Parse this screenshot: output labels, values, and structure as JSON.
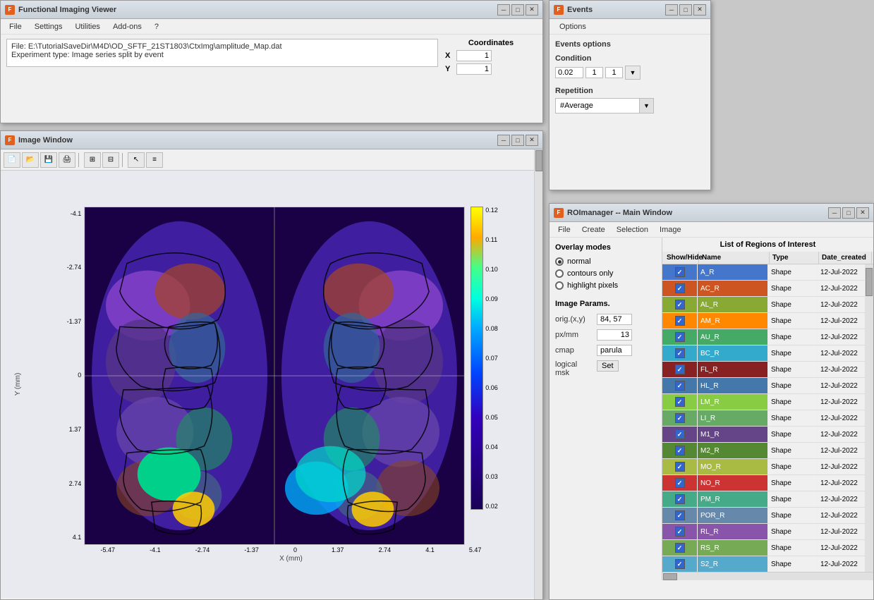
{
  "main_viewer": {
    "title": "Functional Imaging Viewer",
    "file_info": "File: E:\\TutorialSaveDir\\M4D\\OD_SFTF_21ST1803\\CtxImg\\amplitude_Map.dat\nExperiment type: Image series split by event",
    "coordinates": {
      "label": "Coordinates",
      "x_label": "X",
      "y_label": "Y",
      "x_value": "1",
      "y_value": "1"
    },
    "menu": [
      "File",
      "Settings",
      "Utilities",
      "Add-ons",
      "?"
    ]
  },
  "image_window": {
    "title": "Image Window",
    "toolbar_buttons": [
      "new",
      "open",
      "save",
      "print",
      "sep",
      "tool1",
      "tool2",
      "sep",
      "pointer",
      "info"
    ],
    "y_axis_labels": [
      "-4.1",
      "-2.74",
      "-1.37",
      "0",
      "1.37",
      "2.74",
      "4.1"
    ],
    "x_axis_labels": [
      "-5.47",
      "-4.1",
      "-2.74",
      "-1.37",
      "0",
      "1.37",
      "2.74",
      "4.1",
      "5.47"
    ],
    "x_axis_title": "X (mm)",
    "y_axis_title": "Y (mm)",
    "colorbar_labels": [
      "0.12",
      "0.11",
      "0.10",
      "0.09",
      "0.08",
      "0.07",
      "0.06",
      "0.05",
      "0.04",
      "0.03",
      "0.02"
    ]
  },
  "events_window": {
    "title": "Events",
    "options_menu": "Options",
    "events_options_title": "Events options",
    "condition_label": "Condition",
    "condition_value": "0.02",
    "condition_v1": "1",
    "condition_v2": "1",
    "repetition_label": "Repetition",
    "repetition_value": "#Average"
  },
  "roi_manager": {
    "title": "ROImanager -- Main Window",
    "menu": [
      "File",
      "Create",
      "Selection",
      "Image"
    ],
    "list_title": "List of Regions of Interest",
    "overlay_title": "Overlay modes",
    "overlay_options": [
      "normal",
      "contours only",
      "highlight pixels"
    ],
    "selected_overlay": "normal",
    "image_params_title": "Image Params.",
    "params": [
      {
        "label": "orig.(x,y)",
        "value": "84, 57"
      },
      {
        "label": "px/mm",
        "value": "13"
      },
      {
        "label": "cmap",
        "value": "parula"
      },
      {
        "label": "logical\nmsk",
        "btn": "Set"
      }
    ],
    "table_headers": [
      "Show/Hide",
      "Name",
      "Type",
      "Date_created"
    ],
    "rois": [
      {
        "name": "A_R",
        "type": "Shape",
        "date": "12-Jul-2022",
        "color": "#4477cc",
        "checked": true
      },
      {
        "name": "AC_R",
        "type": "Shape",
        "date": "12-Jul-2022",
        "color": "#cc5522",
        "checked": true
      },
      {
        "name": "AL_R",
        "type": "Shape",
        "date": "12-Jul-2022",
        "color": "#88aa33",
        "checked": true
      },
      {
        "name": "AM_R",
        "type": "Shape",
        "date": "12-Jul-2022",
        "color": "#ff8800",
        "checked": true
      },
      {
        "name": "AU_R",
        "type": "Shape",
        "date": "12-Jul-2022",
        "color": "#44aa66",
        "checked": true
      },
      {
        "name": "BC_R",
        "type": "Shape",
        "date": "12-Jul-2022",
        "color": "#33aacc",
        "checked": true
      },
      {
        "name": "FL_R",
        "type": "Shape",
        "date": "12-Jul-2022",
        "color": "#882222",
        "checked": true
      },
      {
        "name": "HL_R",
        "type": "Shape",
        "date": "12-Jul-2022",
        "color": "#4477aa",
        "checked": true
      },
      {
        "name": "LM_R",
        "type": "Shape",
        "date": "12-Jul-2022",
        "color": "#88cc44",
        "checked": true
      },
      {
        "name": "LI_R",
        "type": "Shape",
        "date": "12-Jul-2022",
        "color": "#66aa66",
        "checked": true
      },
      {
        "name": "M1_R",
        "type": "Shape",
        "date": "12-Jul-2022",
        "color": "#664488",
        "checked": true
      },
      {
        "name": "M2_R",
        "type": "Shape",
        "date": "12-Jul-2022",
        "color": "#558833",
        "checked": true
      },
      {
        "name": "MO_R",
        "type": "Shape",
        "date": "12-Jul-2022",
        "color": "#aabb44",
        "checked": true
      },
      {
        "name": "NO_R",
        "type": "Shape",
        "date": "12-Jul-2022",
        "color": "#cc3333",
        "checked": true
      },
      {
        "name": "PM_R",
        "type": "Shape",
        "date": "12-Jul-2022",
        "color": "#44aa88",
        "checked": true
      },
      {
        "name": "POR_R",
        "type": "Shape",
        "date": "12-Jul-2022",
        "color": "#6688aa",
        "checked": true
      },
      {
        "name": "RL_R",
        "type": "Shape",
        "date": "12-Jul-2022",
        "color": "#8855aa",
        "checked": true
      },
      {
        "name": "RS_R",
        "type": "Shape",
        "date": "12-Jul-2022",
        "color": "#77aa55",
        "checked": true
      },
      {
        "name": "S2_R",
        "type": "Shape",
        "date": "12-Jul-2022",
        "color": "#55aacc",
        "checked": true
      }
    ]
  }
}
